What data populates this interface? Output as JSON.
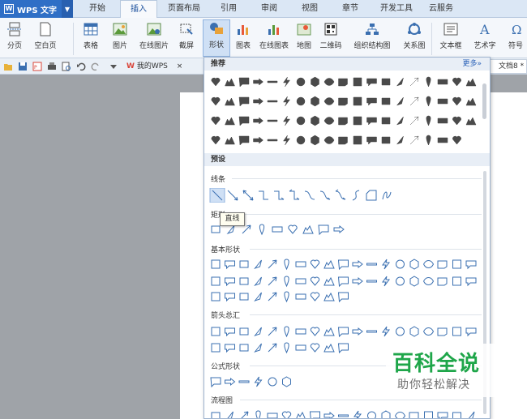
{
  "app": {
    "logo_label": "WPS 文字"
  },
  "menu": {
    "tabs": [
      "开始",
      "插入",
      "页面布局",
      "引用",
      "审阅",
      "视图",
      "章节",
      "开发工具",
      "云服务"
    ],
    "active": "插入"
  },
  "ribbon": {
    "items": [
      "分页",
      "空白页",
      "表格",
      "图片",
      "在线图片",
      "截屏",
      "形状",
      "图表",
      "在线图表",
      "地图",
      "二维码",
      "组织结构图",
      "关系图",
      "文本框",
      "艺术字",
      "符号"
    ],
    "active": "形状"
  },
  "toolbar": {
    "wps_tab": "我的WPS",
    "doc_tab": "文档8 *"
  },
  "panel": {
    "recommended_header": "推荐",
    "more_link": "更多»",
    "preset_header": "预设",
    "sections": [
      "线条",
      "矩形",
      "基本形状",
      "箭头总汇",
      "公式形状",
      "流程图"
    ],
    "hovered_shape": "直线"
  },
  "watermark": {
    "title": "百科全说",
    "subtitle": "助你轻松解决"
  },
  "colors": {
    "accent": "#2f6fc6",
    "shape_fill": "#4a4a4a",
    "shape_outline": "#3a6fb0",
    "watermark_green": "#1fa64a"
  }
}
